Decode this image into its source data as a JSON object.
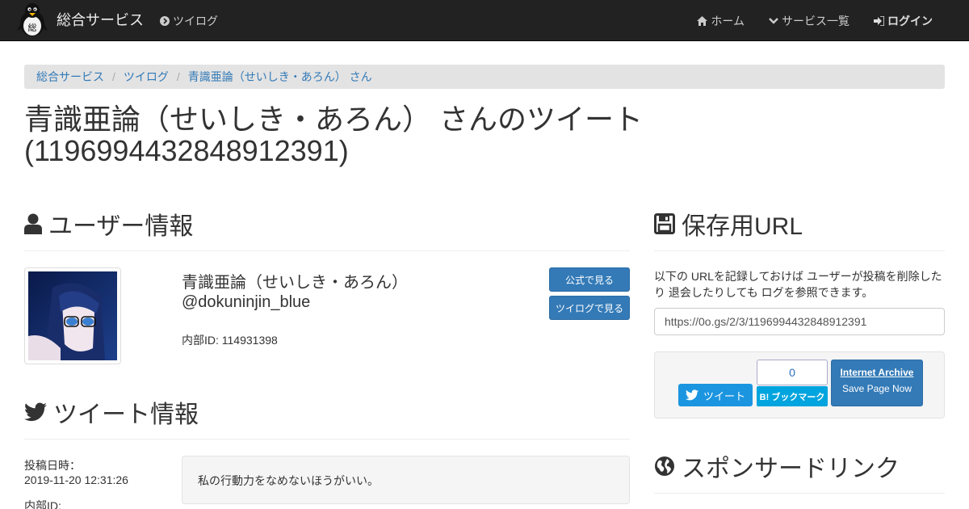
{
  "navbar": {
    "brand": "総合サービス",
    "tsuilog": "ツイログ",
    "home": "ホーム",
    "services": "サービス一覧",
    "login": "ログイン"
  },
  "breadcrumb": [
    "総合サービス",
    "ツイログ",
    "青識亜論（せいしき・あろん） さん"
  ],
  "page_title": "青識亜論（せいしき・あろん） さんのツイート (1196994432848912391)",
  "user_section": {
    "heading": "ユーザー情報",
    "display_name": "青識亜論（せいしき・あろん）",
    "handle": "@dokuninjin_blue",
    "internal_id": "内部ID: 114931398",
    "btn_official": "公式で見る",
    "btn_tsuilog": "ツイログで見る"
  },
  "tweet_section": {
    "heading": "ツイート情報",
    "posted_label": "投稿日時：",
    "posted_value": "2019-11-20 12:31:26",
    "internal_label": "内部ID:",
    "text": "私の行動力をなめないほうがいい。"
  },
  "save_section": {
    "heading": "保存用URL",
    "description": "以下の URLを記録しておけば ユーザーが投稿を削除したり 退会したりしても ログを参照できます。",
    "url": "https://0o.gs/2/3/1196994432848912391",
    "tweet_btn": "ツイート",
    "hatena_count": "0",
    "hatena_btn": "B! ブックマーク",
    "ia_title": "Internet Archive",
    "ia_sub": "Save Page Now"
  },
  "sponsor_section": {
    "heading": "スポンサードリンク"
  }
}
